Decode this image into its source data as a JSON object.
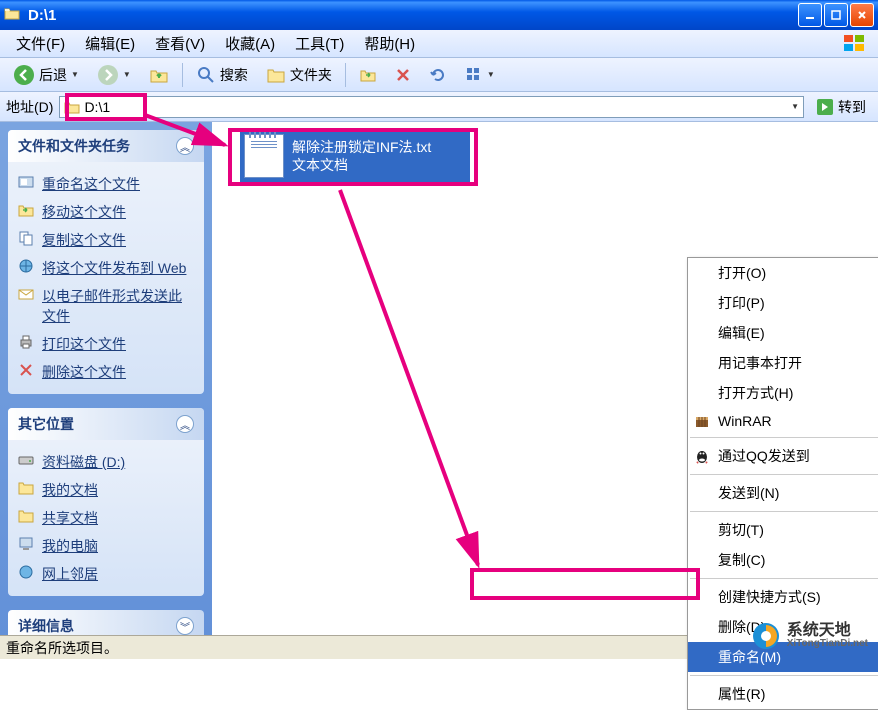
{
  "window": {
    "title": "D:\\1"
  },
  "menu": {
    "file": "文件(F)",
    "edit": "编辑(E)",
    "view": "查看(V)",
    "favorites": "收藏(A)",
    "tools": "工具(T)",
    "help": "帮助(H)"
  },
  "toolbar": {
    "back": "后退",
    "search": "搜索",
    "folders": "文件夹"
  },
  "address": {
    "label": "地址(D)",
    "path": "D:\\1",
    "go": "转到"
  },
  "sidebar": {
    "tasks_panel": {
      "title": "文件和文件夹任务",
      "items": [
        "重命名这个文件",
        "移动这个文件",
        "复制这个文件",
        "将这个文件发布到 Web",
        "以电子邮件形式发送此文件",
        "打印这个文件",
        "删除这个文件"
      ]
    },
    "other_panel": {
      "title": "其它位置",
      "items": [
        "资料磁盘 (D:)",
        "我的文档",
        "共享文档",
        "我的电脑",
        "网上邻居"
      ]
    },
    "detail_panel": {
      "title": "详细信息"
    }
  },
  "file": {
    "name": "解除注册锁定INF法.txt",
    "type": "文本文档"
  },
  "context_menu": {
    "open": "打开(O)",
    "print": "打印(P)",
    "edit": "编辑(E)",
    "notepad": "用记事本打开",
    "open_with": "打开方式(H)",
    "winrar": "WinRAR",
    "qq_send": "通过QQ发送到",
    "send_to": "发送到(N)",
    "cut": "剪切(T)",
    "copy": "复制(C)",
    "shortcut": "创建快捷方式(S)",
    "delete": "删除(D)",
    "rename": "重命名(M)",
    "properties": "属性(R)"
  },
  "statusbar": {
    "text": "重命名所选项目。"
  },
  "watermark": {
    "name": "系统天地",
    "url": "XiTongTianDi.net"
  }
}
